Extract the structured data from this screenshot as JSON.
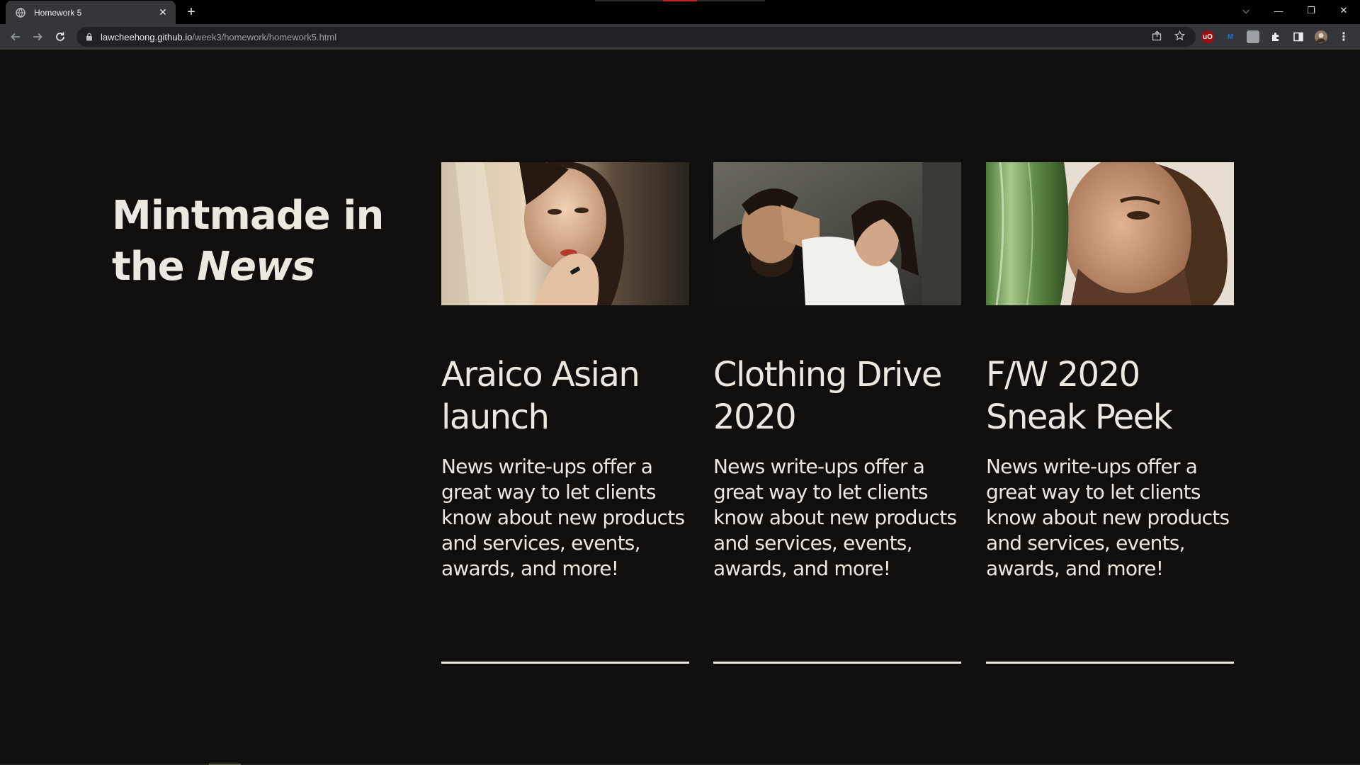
{
  "browser": {
    "tab_title": "Homework 5",
    "tab_close": "✕",
    "new_tab": "+",
    "url_host": "lawcheehong.github.io",
    "url_path": "/week3/homework/homework5.html",
    "window_controls": {
      "dropdown": "⌵",
      "minimize": "—",
      "restore": "❐",
      "close": "✕"
    },
    "extensions": [
      {
        "name": "ublock-icon",
        "label": "uO",
        "color": "#a10d0d"
      },
      {
        "name": "m-extension-icon",
        "label": "M",
        "color": "#1a73e8"
      },
      {
        "name": "image-extension-icon",
        "label": "",
        "color": "#9aa0a6"
      }
    ]
  },
  "page": {
    "heading_line1": "Mintmade in",
    "heading_line2_prefix": "the ",
    "heading_line2_emphasis": "News",
    "cards": [
      {
        "title": "Araico Asian launch",
        "body": "News write-ups offer a great way to let clients know about new products and services, events, awards, and more!"
      },
      {
        "title": "Clothing Drive 2020",
        "body": "News write-ups offer a great way to let clients know about new products and services, events, awards, and more!"
      },
      {
        "title": "F/W 2020 Sneak Peek",
        "body": "News write-ups offer a great way to let clients know about new products and services, events, awards, and more!"
      }
    ]
  },
  "colors": {
    "page_bg": "#100f0e",
    "text": "#ece8df",
    "chrome_bg": "#35363a",
    "tabstrip_bg": "#000000"
  }
}
